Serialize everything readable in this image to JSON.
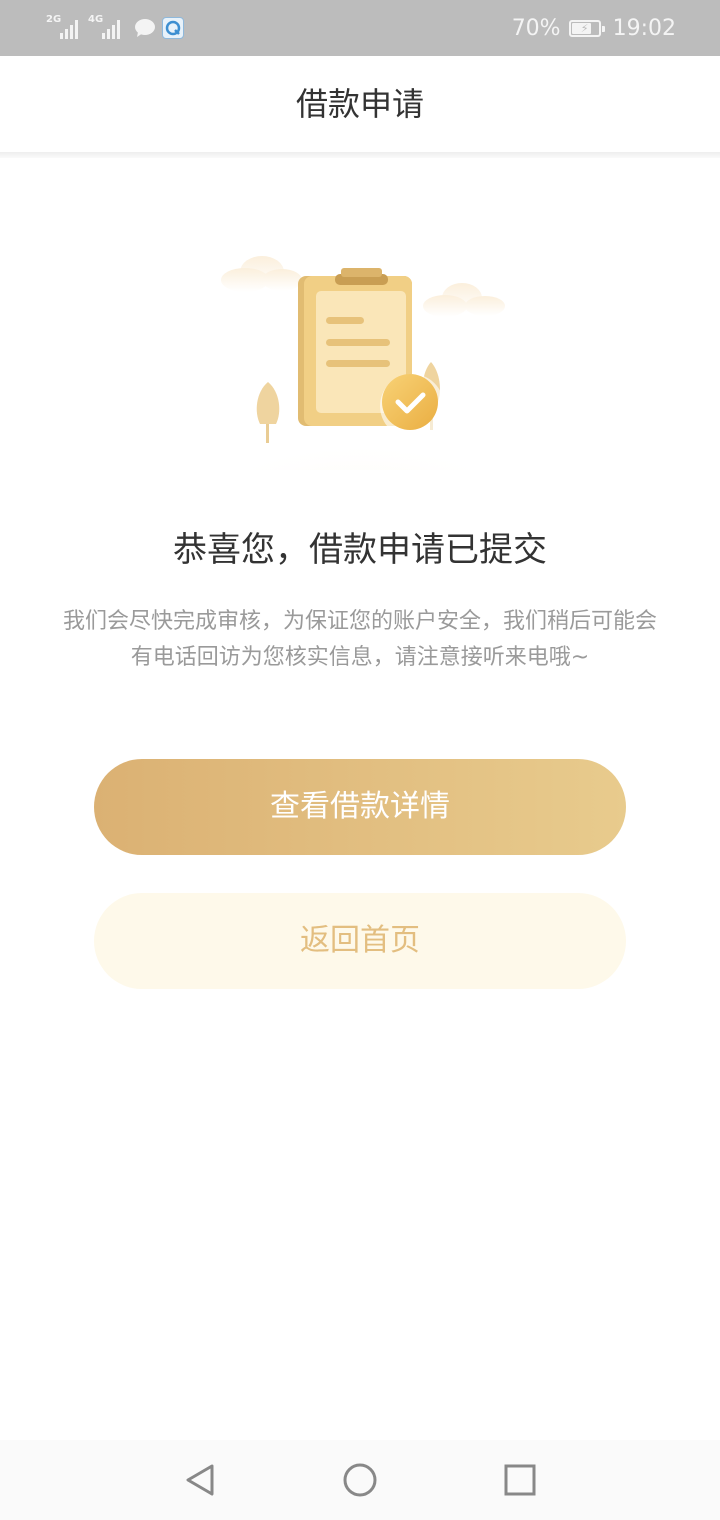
{
  "status_bar": {
    "network_1": "2G",
    "network_2": "4G",
    "battery_percent": "70%",
    "battery_level": 0.7,
    "time": "19:02",
    "icons": [
      "signal-icon",
      "signal-icon",
      "message-icon",
      "app-notification-icon",
      "battery-icon"
    ]
  },
  "header": {
    "title": "借款申请"
  },
  "result": {
    "title": "恭喜您，借款申请已提交",
    "description": "我们会尽快完成审核，为保证您的账户安全，我们稍后可能会有电话回访为您核实信息，请注意接听来电哦~"
  },
  "buttons": {
    "primary_label": "查看借款详情",
    "secondary_label": "返回首页"
  },
  "nav_bar": {
    "icons": [
      "back-icon",
      "home-icon",
      "recents-icon"
    ]
  },
  "colors": {
    "accent_gold_start": "#dbb173",
    "accent_gold_end": "#e8cb8d",
    "secondary_bg": "#fef9ea",
    "secondary_text": "#e3be80",
    "status_bar_bg": "#bcbcbc"
  }
}
